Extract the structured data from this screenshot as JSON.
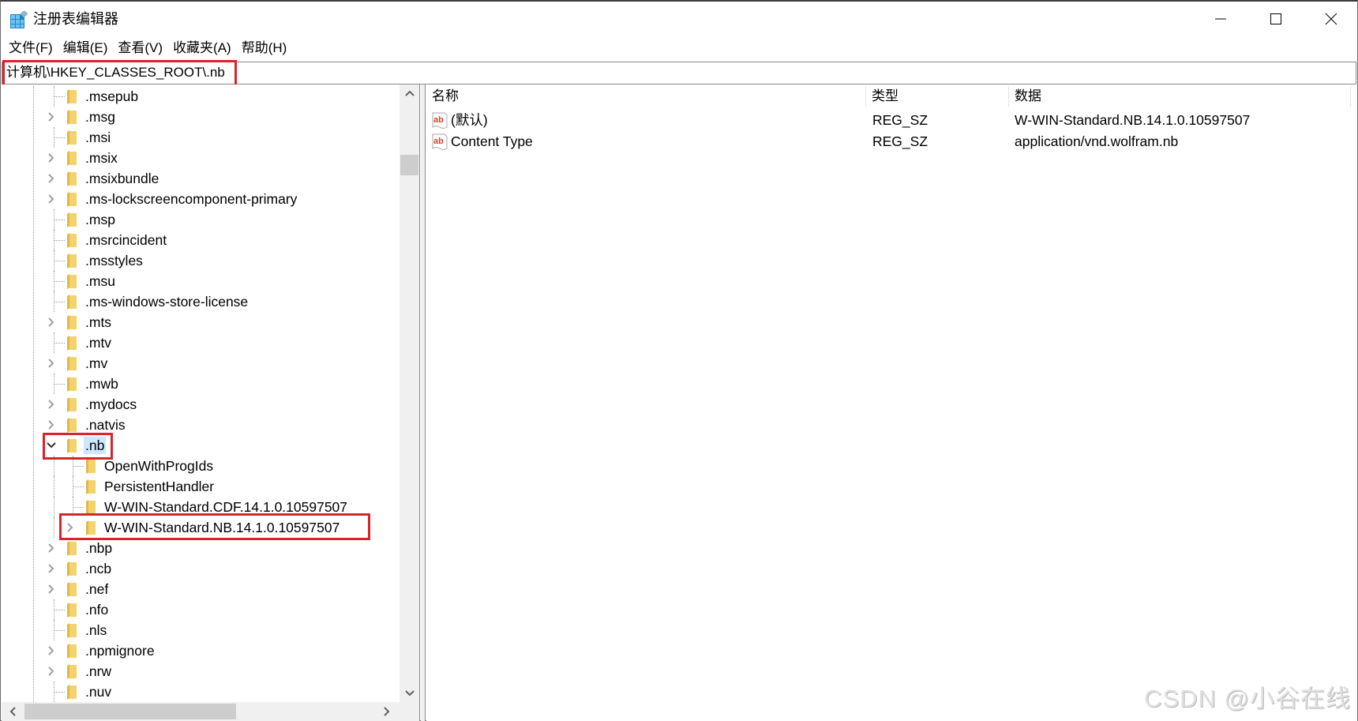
{
  "window": {
    "title": "注册表编辑器",
    "icon": "registry-editor-icon",
    "controls": {
      "minimize": "minimize-icon",
      "maximize": "maximize-icon",
      "close": "close-icon"
    }
  },
  "menubar": {
    "items": [
      {
        "label": "文件(F)"
      },
      {
        "label": "编辑(E)"
      },
      {
        "label": "查看(V)"
      },
      {
        "label": "收藏夹(A)"
      },
      {
        "label": "帮助(H)"
      }
    ]
  },
  "address": {
    "path": "计算机\\HKEY_CLASSES_ROOT\\.nb"
  },
  "tree": {
    "items": [
      {
        "label": ".msepub",
        "level": 1,
        "expander": "none"
      },
      {
        "label": ".msg",
        "level": 1,
        "expander": "collapsed"
      },
      {
        "label": ".msi",
        "level": 1,
        "expander": "none"
      },
      {
        "label": ".msix",
        "level": 1,
        "expander": "collapsed"
      },
      {
        "label": ".msixbundle",
        "level": 1,
        "expander": "collapsed"
      },
      {
        "label": ".ms-lockscreencomponent-primary",
        "level": 1,
        "expander": "collapsed"
      },
      {
        "label": ".msp",
        "level": 1,
        "expander": "none"
      },
      {
        "label": ".msrcincident",
        "level": 1,
        "expander": "none"
      },
      {
        "label": ".msstyles",
        "level": 1,
        "expander": "none"
      },
      {
        "label": ".msu",
        "level": 1,
        "expander": "none"
      },
      {
        "label": ".ms-windows-store-license",
        "level": 1,
        "expander": "none"
      },
      {
        "label": ".mts",
        "level": 1,
        "expander": "collapsed"
      },
      {
        "label": ".mtv",
        "level": 1,
        "expander": "none"
      },
      {
        "label": ".mv",
        "level": 1,
        "expander": "collapsed"
      },
      {
        "label": ".mwb",
        "level": 1,
        "expander": "none"
      },
      {
        "label": ".mydocs",
        "level": 1,
        "expander": "collapsed"
      },
      {
        "label": ".natvis",
        "level": 1,
        "expander": "collapsed"
      },
      {
        "label": ".nb",
        "level": 1,
        "expander": "expanded",
        "selected": true
      },
      {
        "label": "OpenWithProgIds",
        "level": 2,
        "expander": "none"
      },
      {
        "label": "PersistentHandler",
        "level": 2,
        "expander": "none"
      },
      {
        "label": "W-WIN-Standard.CDF.14.1.0.10597507",
        "level": 2,
        "expander": "none"
      },
      {
        "label": "W-WIN-Standard.NB.14.1.0.10597507",
        "level": 2,
        "expander": "collapsed"
      },
      {
        "label": ".nbp",
        "level": 1,
        "expander": "collapsed"
      },
      {
        "label": ".ncb",
        "level": 1,
        "expander": "collapsed"
      },
      {
        "label": ".nef",
        "level": 1,
        "expander": "collapsed"
      },
      {
        "label": ".nfo",
        "level": 1,
        "expander": "none"
      },
      {
        "label": ".nls",
        "level": 1,
        "expander": "none"
      },
      {
        "label": ".npmignore",
        "level": 1,
        "expander": "collapsed"
      },
      {
        "label": ".nrw",
        "level": 1,
        "expander": "collapsed"
      },
      {
        "label": ".nuv",
        "level": 1,
        "expander": "none"
      }
    ],
    "vertical_scroll_fraction": 0.12,
    "horizontal_scroll_fraction": 0.0
  },
  "list": {
    "columns": [
      {
        "label": "名称"
      },
      {
        "label": "类型"
      },
      {
        "label": "数据"
      }
    ],
    "rows": [
      {
        "name": "(默认)",
        "type": "REG_SZ",
        "data": "W-WIN-Standard.NB.14.1.0.10597507",
        "icon": "string-value-icon"
      },
      {
        "name": "Content Type",
        "type": "REG_SZ",
        "data": "application/vnd.wolfram.nb",
        "icon": "string-value-icon"
      }
    ]
  },
  "highlights": {
    "color": "#d9232d",
    "targets": [
      "address-bar",
      "tree-item .nb",
      "tree-item W-WIN-Standard.NB.14.1.0.10597507"
    ]
  },
  "colors": {
    "selection": "#cce8ff",
    "folder": "#f5d36c",
    "scrollbar_track": "#f0f0f0",
    "scrollbar_thumb": "#cdcdcd"
  },
  "watermark": {
    "text": "CSDN @小谷在线"
  }
}
